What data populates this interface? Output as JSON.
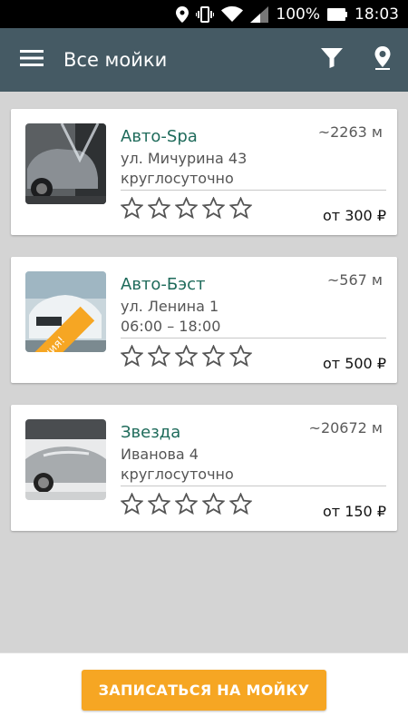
{
  "status_bar": {
    "battery": "100%",
    "time": "18:03"
  },
  "app_bar": {
    "title": "Все мойки"
  },
  "wash_list": [
    {
      "name": "Авто-Spa",
      "distance": "~2263 м",
      "address": "ул. Мичурина 43",
      "hours": "круглосуточно",
      "price": "от 300 ₽",
      "rating": 0,
      "promo": ""
    },
    {
      "name": "Авто-Бэст",
      "distance": "~567 м",
      "address": "ул. Ленина 1",
      "hours": "06:00 – 18:00",
      "price": "от 500 ₽",
      "rating": 0,
      "promo": "Акция!"
    },
    {
      "name": "Звезда",
      "distance": "~20672 м",
      "address": "Иванова 4",
      "hours": "круглосуточно",
      "price": "от 150 ₽",
      "rating": 0,
      "promo": ""
    }
  ],
  "bottom_bar": {
    "cta_label": "ЗАПИСАТЬСЯ НА МОЙКУ"
  },
  "colors": {
    "app_bar": "#455a64",
    "accent": "#f6a623",
    "name_text": "#1f6b5b",
    "background": "#d4d4d4"
  }
}
